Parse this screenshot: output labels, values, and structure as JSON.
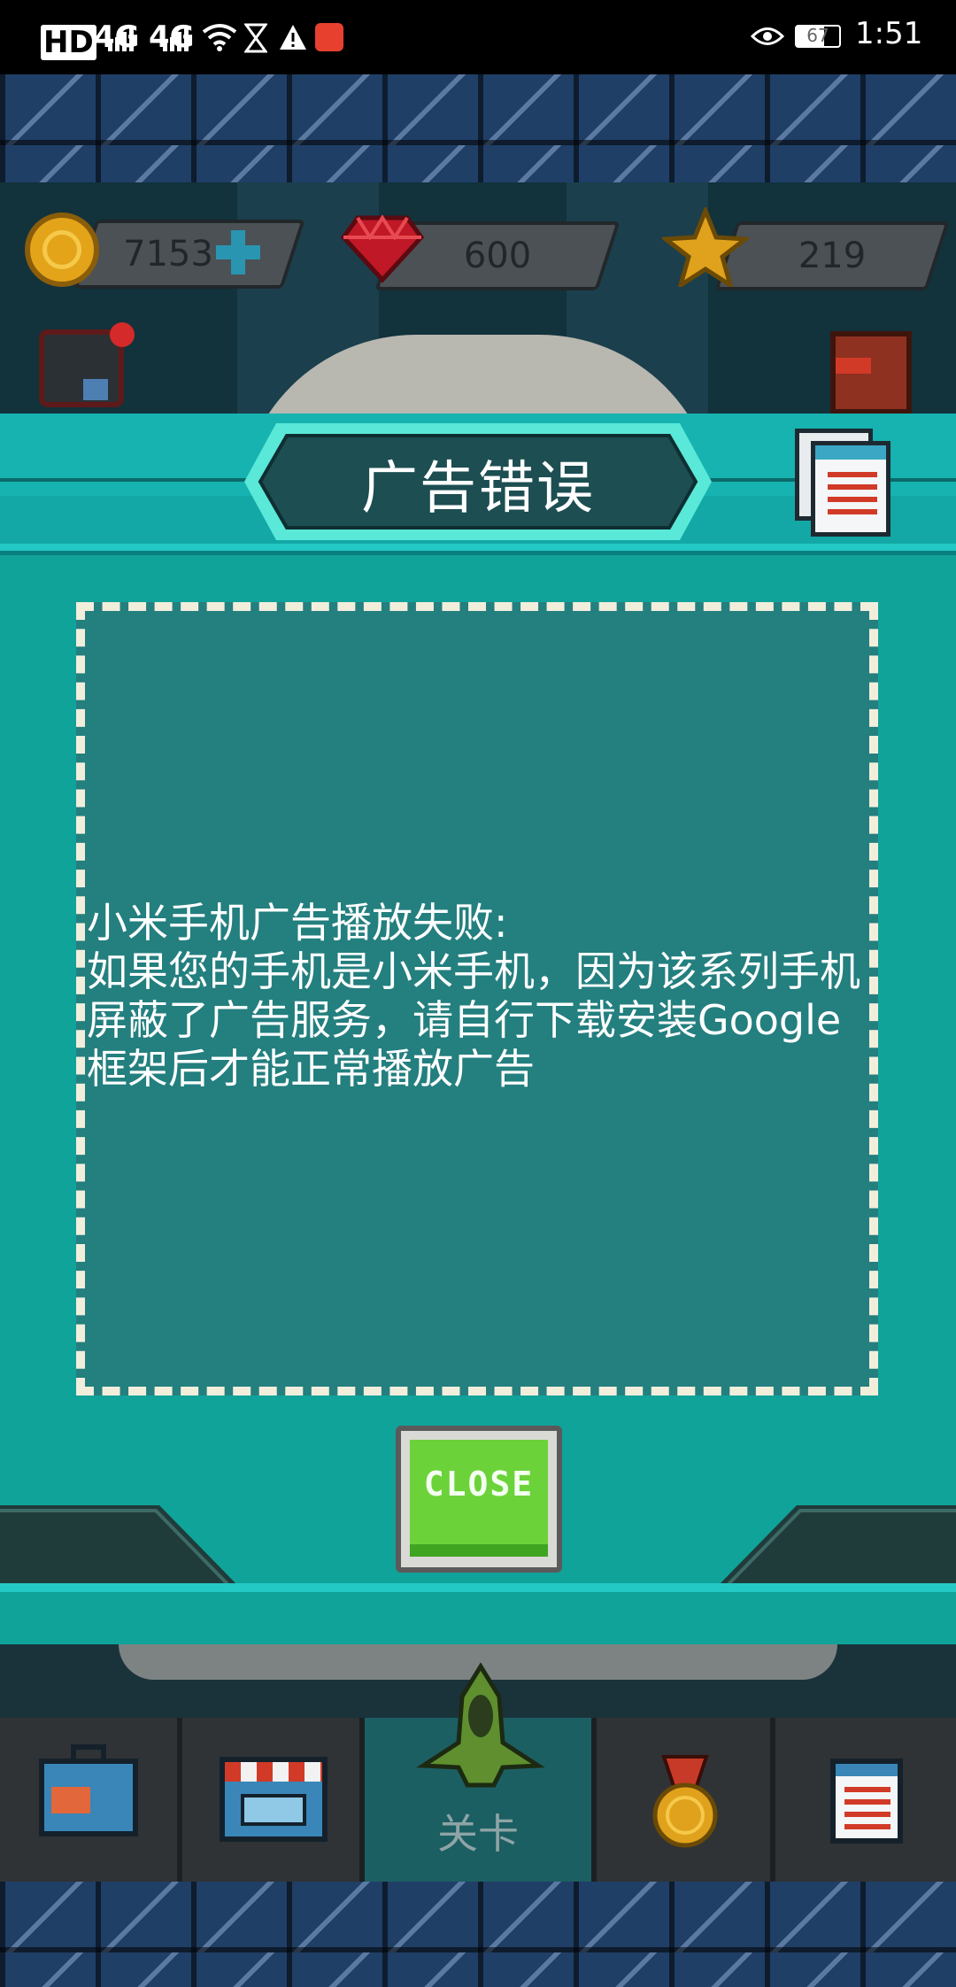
{
  "status_bar": {
    "net_label_1": "HD",
    "net_label_2": "4G",
    "net_label_3": "4G",
    "battery": "67",
    "time": "1:51"
  },
  "currency": {
    "coins": "7153",
    "gems": "600",
    "stars": "219"
  },
  "dialog": {
    "title": "广告错误",
    "message": "小米手机广告播放失败:\n如果您的手机是小米手机，因为该系列手机屏蔽了广告服务，请自行下载安装Google框架后才能正常播放广告",
    "close_label": "CLOSE"
  },
  "bottom_nav": {
    "levels_label": "关卡"
  },
  "colors": {
    "teal": "#10a39a",
    "close_green": "#6cd23a"
  },
  "icons": [
    "hourglass-icon",
    "warning-icon",
    "gift-icon",
    "eye-icon",
    "battery-icon",
    "coin-icon",
    "plus-icon",
    "ruby-icon",
    "star-icon",
    "tv-ad-icon",
    "notification-dot-icon",
    "quest-book-icon",
    "calendar-notes-icon",
    "toolbox-icon",
    "shop-icon",
    "spaceship-icon",
    "medal-icon",
    "task-list-icon"
  ]
}
